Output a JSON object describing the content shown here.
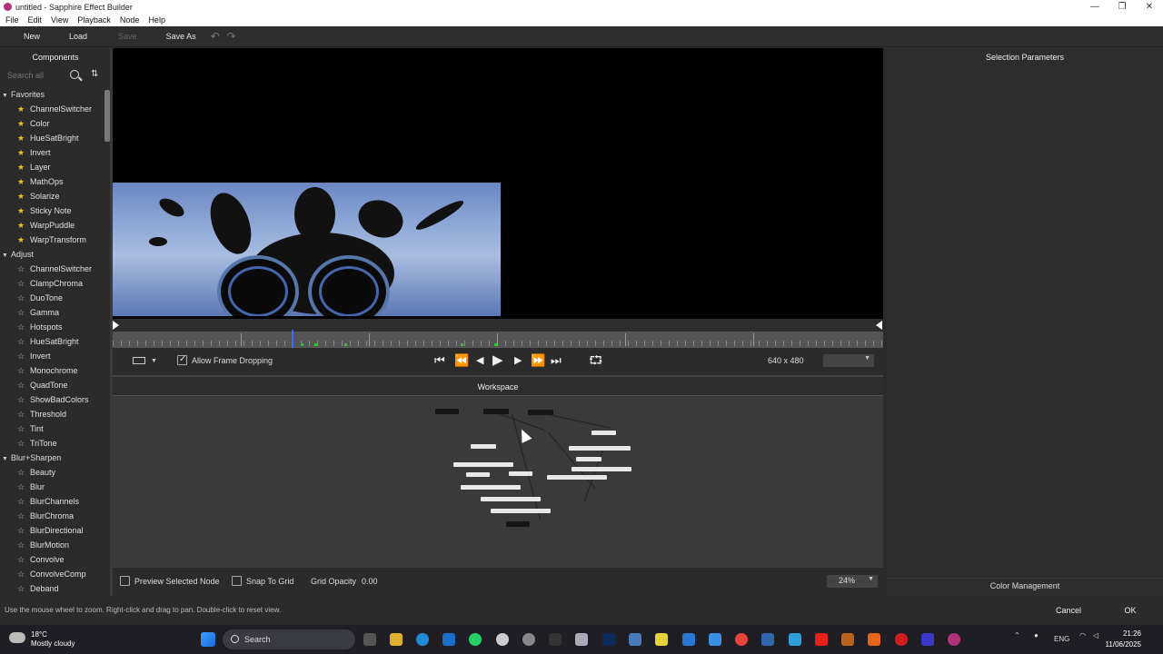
{
  "window": {
    "title": "untitled - Sapphire Effect Builder",
    "minimize": "—",
    "maximize": "❐",
    "close": "✕"
  },
  "menu": [
    "File",
    "Edit",
    "View",
    "Playback",
    "Node",
    "Help"
  ],
  "toolbar": {
    "new": "New",
    "load": "Load",
    "save": "Save",
    "save_as": "Save As",
    "undo": "↶",
    "redo": "↷"
  },
  "components": {
    "header": "Components",
    "search_placeholder": "Search all",
    "categories": [
      {
        "name": "Favorites",
        "items": [
          "ChannelSwitcher",
          "Color",
          "HueSatBright",
          "Invert",
          "Layer",
          "MathOps",
          "Solarize",
          "Sticky Note",
          "WarpPuddle",
          "WarpTransform"
        ]
      },
      {
        "name": "Adjust",
        "items": [
          "ChannelSwitcher",
          "ClampChroma",
          "DuoTone",
          "Gamma",
          "Hotspots",
          "HueSatBright",
          "Invert",
          "Monochrome",
          "QuadTone",
          "ShowBadColors",
          "Threshold",
          "Tint",
          "TriTone"
        ]
      },
      {
        "name": "Blur+Sharpen",
        "items": [
          "Beauty",
          "Blur",
          "BlurChannels",
          "BlurChroma",
          "BlurDirectional",
          "BlurMotion",
          "Convolve",
          "ConvolveComp",
          "Deband"
        ]
      }
    ]
  },
  "transport": {
    "allow_frame_dropping": "Allow Frame Dropping",
    "allow_frame_dropping_checked": true,
    "resolution": "640 x 480",
    "buttons": {
      "first": "⏮",
      "back_fast": "⏪",
      "back": "◀",
      "play": "▶",
      "fwd": "▶",
      "fwd_fast": "⏩",
      "last": "⏭",
      "loop": "⮔"
    }
  },
  "workspace": {
    "header": "Workspace",
    "preview_selected_node": "Preview Selected Node",
    "snap_to_grid": "Snap To Grid",
    "grid_opacity_label": "Grid Opacity",
    "grid_opacity_value": "0.00",
    "zoom": "24%"
  },
  "selection_parameters": {
    "header": "Selection Parameters",
    "color_management": "Color Management"
  },
  "status": {
    "message": "Use the mouse wheel to zoom.  Right-click and drag to pan. Double-click to reset view.",
    "cancel": "Cancel",
    "ok": "OK"
  },
  "taskbar": {
    "weather_temp": "18°C",
    "weather_desc": "Mostly cloudy",
    "search": "Search",
    "lang": "ENG",
    "time": "21:26",
    "date": "11/06/2025"
  },
  "colors": {
    "accent_playhead": "#3a6aff",
    "star": "#f0c020",
    "app_icon": "#b0307a"
  }
}
